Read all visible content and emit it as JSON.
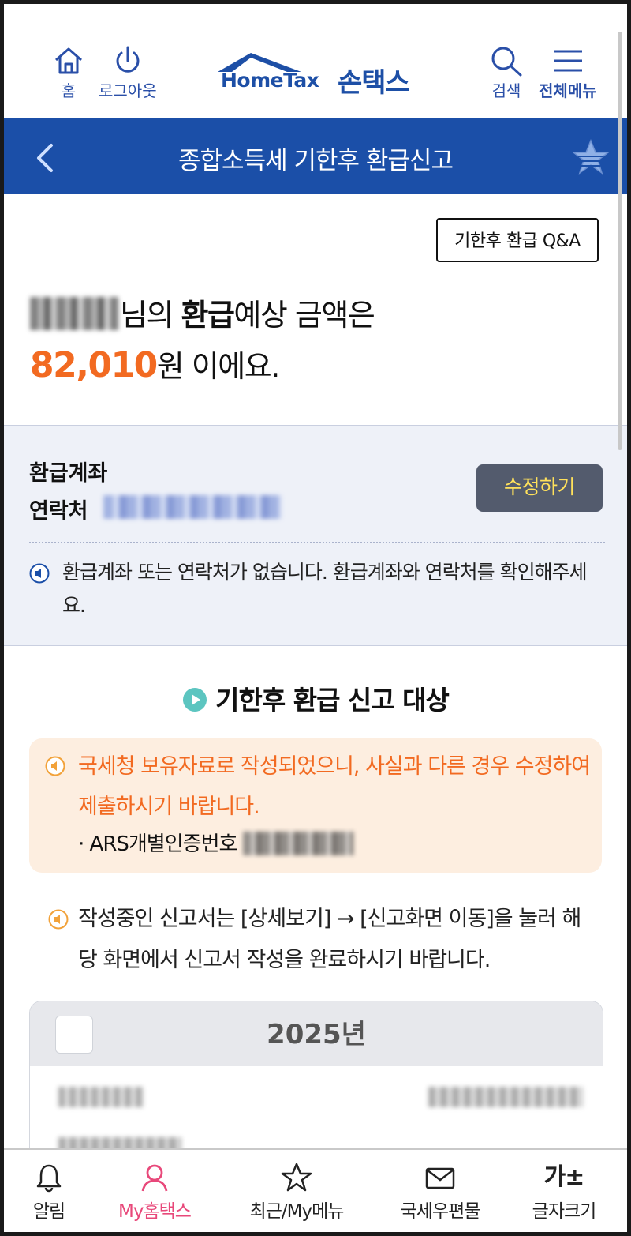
{
  "topbar": {
    "home_label": "홈",
    "logout_label": "로그아웃",
    "logo_text": "HomeTax",
    "logo_korean": "손택스",
    "search_label": "검색",
    "menu_label": "전체메뉴"
  },
  "titlebar": {
    "title": "종합소득세 기한후 환급신고"
  },
  "qa_button": "기한후 환급 Q&A",
  "refund": {
    "line1_suffix_a": "님의 ",
    "line1_bold": "환급",
    "line1_suffix_b": "예상 금액은",
    "amount": "82,010",
    "line2_suffix": "원 이에요."
  },
  "account": {
    "label_account": "환급계좌",
    "label_contact": "연락처",
    "edit_button": "수정하기",
    "notice": "환급계좌 또는 연락처가 없습니다. 환급계좌와 연락처를 확인해주세요."
  },
  "section_title": "기한후 환급 신고 대상",
  "warning": {
    "text": "국세청 보유자료로 작성되었으니, 사실과 다른 경우 수정하여 제출하시기 바랍니다.",
    "ars_label": "· ARS개별인증번호"
  },
  "note": "작성중인 신고서는 [상세보기] → [신고화면 이동]을 눌러 해당 화면에서 신고서 작성을 완료하시기 바랍니다.",
  "card": {
    "year": "2025년"
  },
  "bottomnav": {
    "alarm": "알림",
    "my_hometax": "My홈택스",
    "recent_menu": "최근/My메뉴",
    "mail": "국세우편물",
    "font_size": "글자크기",
    "font_size_glyph": "가±"
  },
  "colors": {
    "brand_blue": "#1b4fa8",
    "accent_orange": "#f26a21",
    "active_pink": "#e8487a",
    "edit_text": "#ffe15b"
  }
}
